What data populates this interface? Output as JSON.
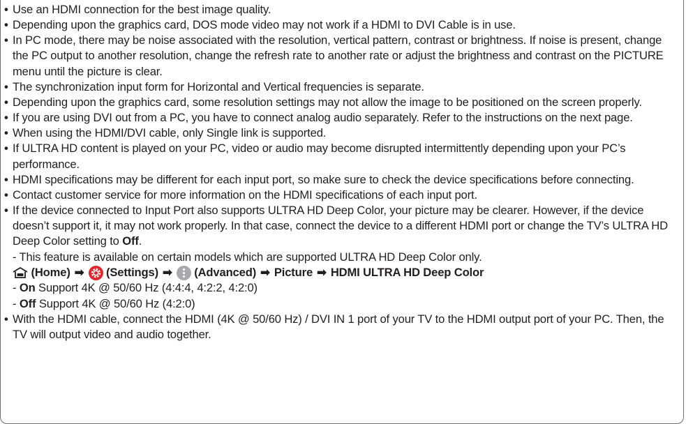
{
  "bullets": [
    "Use an HDMI connection for the best image quality.",
    "Depending upon the graphics card, DOS mode video may not work if a HDMI to DVI Cable is in use.",
    "In PC mode, there may be noise associated with the resolution, vertical pattern, contrast or brightness. If noise is present, change the PC output to another resolution, change the refresh rate to another rate or adjust the brightness and contrast on the PICTURE menu until the picture is clear.",
    "The synchronization input form for Horizontal and Vertical frequencies is separate.",
    "Depending upon the graphics card, some resolution settings may not allow the image to be positioned on the screen properly.",
    "If you are using DVI out from a PC, you have to connect analog audio separately. Refer to the instructions on the next page.",
    "When using the HDMI/DVI cable, only Single link is supported.",
    "If ULTRA HD content is played on your PC, video or audio may become disrupted intermittently depending upon your PC’s performance.",
    "HDMI specifications may be different for each input port, so make sure to check the device specifications before connecting.",
    "Contact customer service for more information on the HDMI specifications of each input port."
  ],
  "deep_color": {
    "text": "If the device connected to Input Port also supports ULTRA HD Deep Color, your picture may be clearer. However, if the device doesn’t support it, it may not work properly. In that case, connect the device to a different HDMI port or change the TV’s ULTRA HD Deep Color setting to ",
    "off_word": "Off",
    "end": ".",
    "note": "- This feature is available on certain models which are supported ULTRA HD Deep Color only.",
    "nav": {
      "home": "(Home)",
      "settings": "(Settings)",
      "advanced": "(Advanced)",
      "picture": "Picture",
      "target": "HDMI ULTRA HD Deep Color",
      "arrow": "➡"
    },
    "options": [
      {
        "dash": "- ",
        "label": "On",
        "desc": " Support 4K @ 50/60 Hz (4:4:4, 4:2:2, 4:2:0)"
      },
      {
        "dash": "- ",
        "label": "Off",
        "desc": " Support 4K @ 50/60 Hz (4:2:0)"
      }
    ]
  },
  "last_bullet": "With the HDMI cable, connect the HDMI (4K @ 50/60 Hz) / DVI IN 1 port of your TV to the HDMI output port of your PC. Then, the TV will output video and audio together.",
  "colors": {
    "text": "#231f20",
    "border": "#6d6e71",
    "settings_red": "#e1262c",
    "advanced_gray": "#a7a9ac"
  }
}
